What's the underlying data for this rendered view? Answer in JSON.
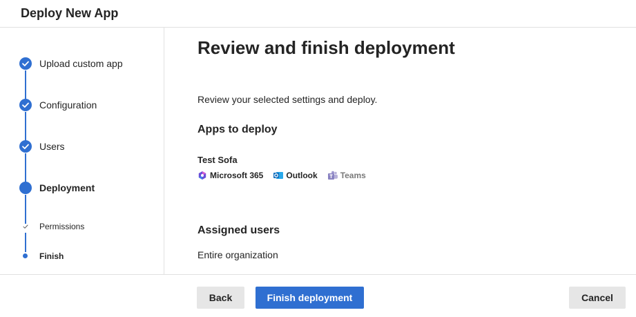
{
  "header": {
    "title": "Deploy New App"
  },
  "steps": [
    {
      "label": "Upload custom app",
      "state": "done"
    },
    {
      "label": "Configuration",
      "state": "done"
    },
    {
      "label": "Users",
      "state": "done"
    },
    {
      "label": "Deployment",
      "state": "current"
    },
    {
      "label": "Permissions",
      "state": "sub-done"
    },
    {
      "label": "Finish",
      "state": "sub-current"
    }
  ],
  "main": {
    "title": "Review and finish deployment",
    "intro": "Review your selected settings and deploy.",
    "apps_heading": "Apps to deploy",
    "app_name": "Test Sofa",
    "hosts": [
      {
        "label": "Microsoft 365",
        "icon": "microsoft-365-icon",
        "enabled": true
      },
      {
        "label": "Outlook",
        "icon": "outlook-icon",
        "enabled": true
      },
      {
        "label": "Teams",
        "icon": "teams-icon",
        "enabled": false
      }
    ],
    "users_heading": "Assigned users",
    "users_value": "Entire organization"
  },
  "footer": {
    "back_label": "Back",
    "finish_label": "Finish deployment",
    "cancel_label": "Cancel"
  },
  "colors": {
    "accent": "#2f6fd1",
    "secondary_button": "#e6e6e6",
    "divider": "#e1e1e1"
  }
}
